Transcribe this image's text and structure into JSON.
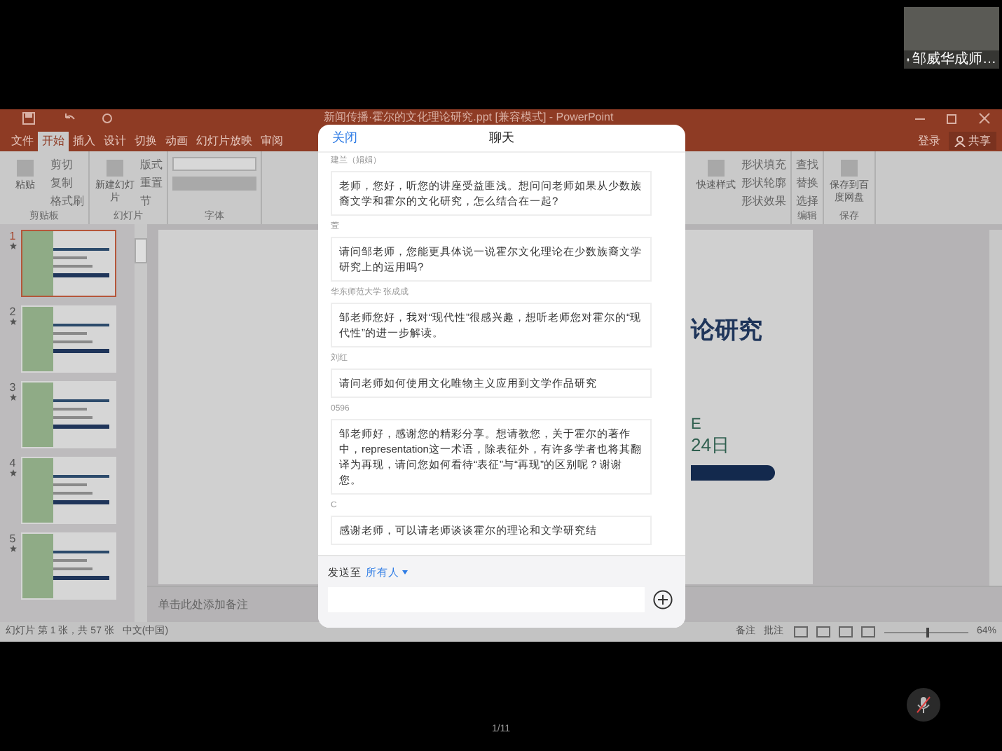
{
  "video_tile": {
    "name": "邹威华成师…",
    "muted": false
  },
  "powerpoint": {
    "title": "新闻传播·霍尔的文化理论研究.ppt [兼容模式] - PowerPoint",
    "tabs": [
      {
        "label": "文件",
        "selected": false
      },
      {
        "label": "开始",
        "selected": true
      },
      {
        "label": "插入",
        "selected": false
      },
      {
        "label": "设计",
        "selected": false
      },
      {
        "label": "切换",
        "selected": false
      },
      {
        "label": "动画",
        "selected": false
      },
      {
        "label": "幻灯片放映",
        "selected": false
      },
      {
        "label": "审阅",
        "selected": false
      }
    ],
    "account": {
      "sign_in": "登录",
      "share": "共享"
    },
    "ribbon_left": [
      {
        "label": "剪贴板",
        "big": "粘贴",
        "items": [
          "剪切",
          "复制",
          "格式刷"
        ]
      },
      {
        "label": "幻灯片",
        "big": "新建幻灯片",
        "items": [
          "版式",
          "重置",
          "节"
        ]
      },
      {
        "label": "字体"
      }
    ],
    "ribbon_right": [
      {
        "big": "快速样式",
        "items": [
          "形状填充",
          "形状轮廓",
          "形状效果"
        ]
      },
      {
        "label": "编辑",
        "items": [
          "查找",
          "替换",
          "选择"
        ]
      },
      {
        "label": "保存",
        "big": "保存到百度网盘"
      }
    ],
    "thumbnails": [
      {
        "number": "1",
        "selected": true
      },
      {
        "number": "2",
        "selected": false
      },
      {
        "number": "3",
        "selected": false
      },
      {
        "number": "4",
        "selected": false
      },
      {
        "number": "5",
        "selected": false
      }
    ],
    "slide_text": [
      "论研究",
      "E",
      "24日"
    ],
    "notes_placeholder": "单击此处添加备注",
    "status_bar": {
      "slide_info": "幻灯片 第 1 张，共 57 张",
      "language": "中文(中国)",
      "notes": "备注",
      "comments": "批注",
      "zoom": "64%",
      "zoom_slider": {
        "level": 0.5
      }
    }
  },
  "chat": {
    "close": "关闭",
    "title": "聊天",
    "messages": [
      {
        "sender": "建兰（娟娟）",
        "text": "老师，您好，听您的讲座受益匪浅。想问问老师如果从少数族裔文学和霍尔的文化研究，怎么结合在一起?"
      },
      {
        "sender": "萱",
        "text": "请问邹老师，您能更具体说一说霍尔文化理论在少数族裔文学研究上的运用吗?"
      },
      {
        "sender": "华东师范大学 张成成",
        "text": "邹老师您好，我对“现代性”很感兴趣，想听老师您对霍尔的“现代性”的进一步解读。"
      },
      {
        "sender": "刘红",
        "text": "请问老师如何使用文化唯物主义应用到文学作品研究"
      },
      {
        "sender": "0596",
        "text": "邹老师好，感谢您的精彩分享。想请教您，关于霍尔的著作中，representation这一术语，除表征外，有许多学者也将其翻译为再现，请问您如何看待“表征”与“再现”的区别呢？谢谢您。"
      },
      {
        "sender": "C",
        "text": "感谢老师，可以请老师谈谈霍尔的理论和文学研究结"
      }
    ],
    "send_to_label": "发送至",
    "recipient": "所有人"
  },
  "page_indicator": "1/11",
  "mic": {
    "muted": true
  }
}
